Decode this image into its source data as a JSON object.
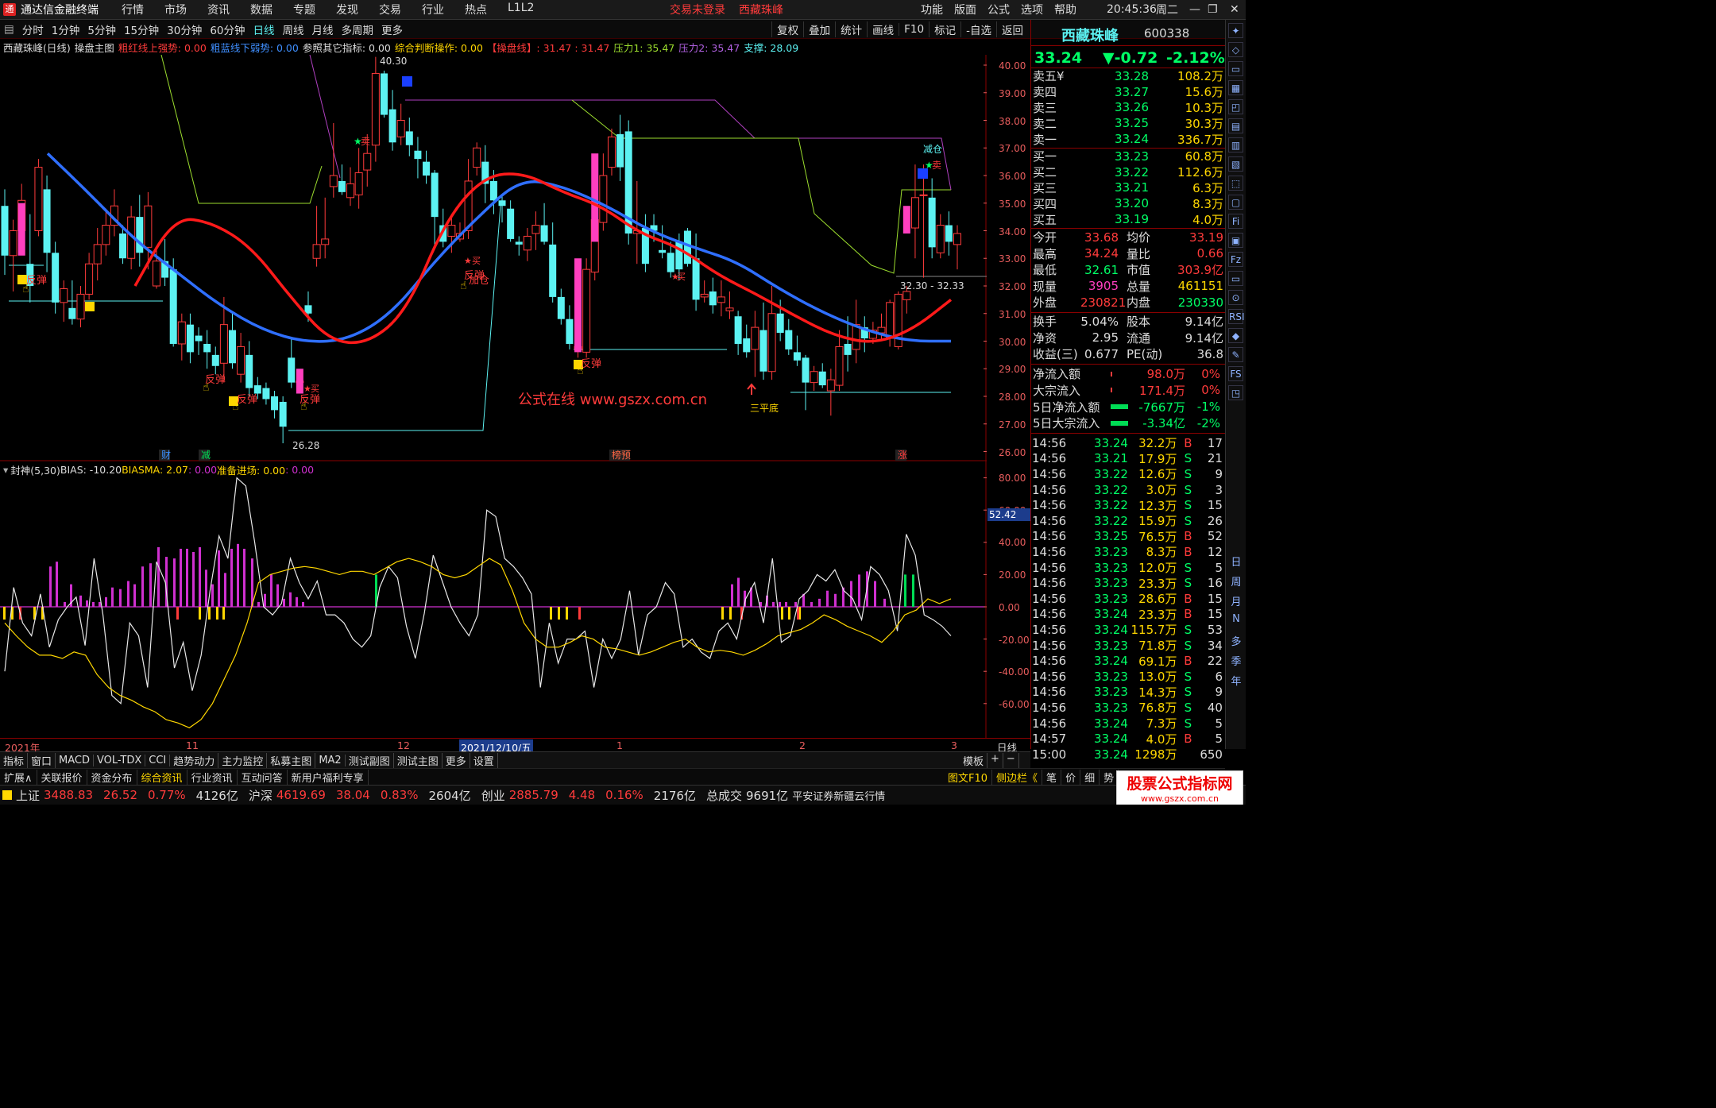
{
  "title_bar": {
    "app": "通达信金融终端",
    "menus": [
      "行情",
      "市场",
      "资讯",
      "数据",
      "专题",
      "发现",
      "交易",
      "行业",
      "热点",
      "L1L2"
    ],
    "login": "交易未登录",
    "stock_name": "西藏珠峰",
    "right_menus": [
      "功能",
      "版面",
      "公式",
      "选项",
      "帮助"
    ],
    "time": "20:45:36",
    "weekday": "周二"
  },
  "period_bar": {
    "periods": [
      "分时",
      "1分钟",
      "5分钟",
      "15分钟",
      "30分钟",
      "60分钟",
      "日线",
      "周线",
      "月线",
      "多周期",
      "更多"
    ],
    "active": "日线",
    "tools": [
      "复权",
      "叠加",
      "统计",
      "画线",
      "F10",
      "标记",
      "-自选",
      "返回"
    ]
  },
  "main_info": {
    "stock": "西藏珠峰(日线)",
    "formula": "操盘主图",
    "red_line": "粗红线上强势: 0.00",
    "blue_line": "粗蓝线下弱势: 0.00",
    "ref": "参照其它指标: 0.00",
    "judge": "综合判断操作: 0.00",
    "pan": "【操盘线】: 31.47 : 31.47",
    "p1": "压力1: 35.47",
    "p2": "压力2: 35.47",
    "support": "支撑: 28.09"
  },
  "price_axis": [
    "40.00",
    "39.00",
    "38.00",
    "37.00",
    "36.00",
    "35.00",
    "34.00",
    "33.00",
    "32.00",
    "31.00",
    "30.00",
    "29.00",
    "28.00",
    "27.00",
    "26.00"
  ],
  "annotations": {
    "high": "40.30",
    "low": "26.28",
    "range": "32.30 - 32.33",
    "rebound": "反弹",
    "buy": "买",
    "sell": "卖",
    "add": "加仓",
    "reduce": "减仓",
    "triple_bottom": "三平底",
    "watermark": "公式在线 www.gszx.com.cn",
    "buy_rebound": "买反弹",
    "markers": [
      "财",
      "减",
      "榜预",
      "涨"
    ]
  },
  "sub_info": {
    "name": "封神(5,30)",
    "bias": "BIAS: -10.20",
    "biasma": "BIASMA: 2.07",
    "v1": ": 0.00",
    "ready": "准备进场: 0.00",
    "v2": ": 0.00"
  },
  "sub_axis": [
    "80.00",
    "60.00",
    "40.00",
    "20.00",
    "0.00",
    "-20.00",
    "-40.00",
    "-60.00"
  ],
  "sub_marker": "52.42",
  "date_axis": {
    "labels": [
      "2021年",
      "11",
      "12",
      "2021/12/10/五",
      "1",
      "2",
      "3"
    ],
    "period": "日线"
  },
  "bottom_tabs": [
    "指标",
    "窗口",
    "MACD",
    "VOL-TDX",
    "CCI",
    "趋势动力",
    "主力监控",
    "私募主图",
    "MA2",
    "测试副图",
    "测试主图",
    "更多",
    "设置"
  ],
  "bottom_tabs_right": [
    "模板",
    "+",
    "−"
  ],
  "bottom_tabs2": [
    "扩展∧",
    "关联报价",
    "资金分布",
    "综合资讯",
    "行业资讯",
    "互动问答",
    "新用户福利专享"
  ],
  "bottom_tabs2_right": [
    "图文F10",
    "侧边栏《",
    "笔",
    "价",
    "细",
    "势"
  ],
  "status_bar": {
    "sh_label": "上证",
    "sh": "3488.83",
    "sh_chg": "26.52",
    "sh_pct": "0.77%",
    "sh_amt": "4126亿",
    "sz_label": "沪深",
    "sz": "4619.69",
    "sz_chg": "38.04",
    "sz_pct": "0.83%",
    "sz_amt": "2604亿",
    "cy_label": "创业",
    "cy": "2885.79",
    "cy_chg": "4.48",
    "cy_pct": "0.16%",
    "cy_amt": "2176亿",
    "total_label": "总成交",
    "total": "9691亿",
    "broker": "平安证券新疆云行情",
    "brand": "股票公式指标网",
    "brand_url": "www.gszx.com.cn"
  },
  "quote": {
    "name": "西藏珠峰",
    "code": "600338",
    "price": "33.24",
    "change": "▼-0.72",
    "pct": "-2.12%",
    "asks": [
      {
        "l": "卖五¥",
        "p": "33.28",
        "v": "108.2万"
      },
      {
        "l": "卖四",
        "p": "33.27",
        "v": "15.6万"
      },
      {
        "l": "卖三",
        "p": "33.26",
        "v": "10.3万"
      },
      {
        "l": "卖二",
        "p": "33.25",
        "v": "30.3万"
      },
      {
        "l": "卖一",
        "p": "33.24",
        "v": "336.7万"
      }
    ],
    "bids": [
      {
        "l": "买一",
        "p": "33.23",
        "v": "60.8万"
      },
      {
        "l": "买二",
        "p": "33.22",
        "v": "112.6万"
      },
      {
        "l": "买三",
        "p": "33.21",
        "v": "6.3万"
      },
      {
        "l": "买四",
        "p": "33.20",
        "v": "8.3万"
      },
      {
        "l": "买五",
        "p": "33.19",
        "v": "4.0万"
      }
    ],
    "stats": [
      [
        "今开",
        "33.68",
        "均价",
        "33.19"
      ],
      [
        "最高",
        "34.24",
        "量比",
        "0.66"
      ],
      [
        "最低",
        "32.61",
        "市值",
        "303.9亿"
      ],
      [
        "现量",
        "3905",
        "总量",
        "461151"
      ],
      [
        "外盘",
        "230821",
        "内盘",
        "230330"
      ]
    ],
    "stats2": [
      [
        "换手",
        "5.04%",
        "股本",
        "9.14亿"
      ],
      [
        "净资",
        "2.95",
        "流通",
        "9.14亿"
      ],
      [
        "收益(三)",
        "0.677",
        "PE(动)",
        "36.8"
      ]
    ],
    "flows": [
      [
        "净流入额",
        "98.0万",
        "0%"
      ],
      [
        "大宗流入",
        "171.4万",
        "0%"
      ],
      [
        "5日净流入额",
        "-7667万",
        "-1%"
      ],
      [
        "5日大宗流入",
        "-3.34亿",
        "-2%"
      ]
    ]
  },
  "ticks": [
    [
      "14:56",
      "33.24",
      "32.2万",
      "B",
      "17"
    ],
    [
      "14:56",
      "33.21",
      "17.9万",
      "S",
      "21"
    ],
    [
      "14:56",
      "33.22",
      "12.6万",
      "S",
      "9"
    ],
    [
      "14:56",
      "33.22",
      "3.0万",
      "S",
      "3"
    ],
    [
      "14:56",
      "33.22",
      "12.3万",
      "S",
      "15"
    ],
    [
      "14:56",
      "33.22",
      "15.9万",
      "S",
      "26"
    ],
    [
      "14:56",
      "33.25",
      "76.5万",
      "B",
      "52"
    ],
    [
      "14:56",
      "33.23",
      "8.3万",
      "B",
      "12"
    ],
    [
      "14:56",
      "33.23",
      "12.0万",
      "S",
      "5"
    ],
    [
      "14:56",
      "33.23",
      "23.3万",
      "S",
      "16"
    ],
    [
      "14:56",
      "33.23",
      "28.6万",
      "B",
      "15"
    ],
    [
      "14:56",
      "33.24",
      "23.3万",
      "B",
      "15"
    ],
    [
      "14:56",
      "33.24",
      "115.7万",
      "S",
      "53"
    ],
    [
      "14:56",
      "33.23",
      "71.8万",
      "S",
      "34"
    ],
    [
      "14:56",
      "33.24",
      "69.1万",
      "B",
      "22"
    ],
    [
      "14:56",
      "33.23",
      "13.0万",
      "S",
      "6"
    ],
    [
      "14:56",
      "33.23",
      "14.3万",
      "S",
      "9"
    ],
    [
      "14:56",
      "33.23",
      "76.8万",
      "S",
      "40"
    ],
    [
      "14:56",
      "33.24",
      "7.3万",
      "S",
      "5"
    ],
    [
      "14:57",
      "33.24",
      "4.0万",
      "B",
      "5"
    ],
    [
      "15:00",
      "33.24",
      "1298万",
      "",
      "650"
    ]
  ],
  "side_icons": [
    "日",
    "周",
    "月",
    "N",
    "多",
    "季",
    "年"
  ],
  "colors": {
    "up": "#ff3b3b",
    "down": "#5cf2f2",
    "yellow": "#ffd700",
    "magenta": "#ff3fbf",
    "blue_ma": "#2f6fff",
    "red_ma": "#ff1a1a",
    "green": "#00ff66",
    "purple": "#b040c0",
    "lime": "#9cdd2e"
  },
  "chart_data": {
    "type": "candlestick",
    "candles": [
      [
        34.9,
        35.5,
        32.4,
        33.1
      ],
      [
        33.1,
        34.4,
        31.8,
        34.0
      ],
      [
        34.0,
        35.7,
        33.4,
        35.1
      ],
      [
        32.8,
        34.6,
        31.4,
        32.0
      ],
      [
        34.0,
        36.6,
        33.8,
        36.3
      ],
      [
        35.5,
        36.0,
        32.5,
        33.2
      ],
      [
        33.2,
        33.6,
        31.0,
        31.4
      ],
      [
        31.4,
        32.2,
        30.7,
        31.9
      ],
      [
        31.2,
        32.2,
        30.6,
        30.8
      ],
      [
        30.8,
        32.0,
        30.5,
        31.7
      ],
      [
        31.7,
        33.2,
        31.5,
        32.8
      ],
      [
        32.8,
        34.1,
        32.2,
        33.5
      ],
      [
        33.5,
        34.8,
        33.1,
        34.2
      ],
      [
        34.2,
        35.5,
        33.8,
        34.9
      ],
      [
        33.9,
        34.2,
        32.8,
        33.0
      ],
      [
        33.0,
        34.9,
        32.6,
        34.5
      ],
      [
        34.5,
        35.3,
        32.7,
        33.2
      ],
      [
        33.4,
        35.4,
        32.6,
        34.9
      ],
      [
        32.0,
        33.3,
        31.9,
        32.9
      ],
      [
        32.9,
        33.7,
        32.0,
        32.3
      ],
      [
        32.6,
        33.0,
        29.8,
        29.9
      ],
      [
        29.9,
        31.0,
        29.3,
        30.7
      ],
      [
        30.6,
        31.0,
        29.2,
        29.6
      ],
      [
        30.2,
        30.5,
        29.5,
        30.0
      ],
      [
        29.9,
        30.4,
        29.0,
        29.6
      ],
      [
        29.5,
        29.8,
        28.8,
        29.1
      ],
      [
        29.2,
        31.6,
        28.5,
        30.6
      ],
      [
        30.4,
        31.0,
        29.0,
        29.2
      ],
      [
        28.8,
        30.3,
        28.5,
        29.8
      ],
      [
        29.5,
        30.0,
        28.0,
        28.3
      ],
      [
        28.4,
        28.7,
        27.9,
        28.1
      ],
      [
        28.3,
        28.5,
        27.7,
        27.9
      ],
      [
        28.0,
        28.2,
        27.2,
        27.5
      ],
      [
        27.8,
        28.0,
        26.3,
        26.9
      ],
      [
        29.4,
        30.1,
        28.3,
        28.5
      ],
      [
        28.5,
        28.6,
        28.4,
        28.55
      ],
      [
        31.3,
        31.8,
        30.7,
        31.0
      ],
      [
        33.0,
        34.9,
        32.7,
        33.5
      ],
      [
        33.5,
        35.2,
        33.0,
        33.7
      ],
      [
        35.6,
        37.9,
        35.2,
        36.0
      ],
      [
        35.8,
        36.4,
        35.3,
        35.4
      ],
      [
        35.2,
        36.3,
        34.9,
        35.7
      ],
      [
        35.3,
        37.0,
        34.8,
        36.1
      ],
      [
        36.2,
        37.5,
        35.6,
        36.8
      ],
      [
        37.1,
        40.3,
        36.5,
        39.7
      ],
      [
        39.7,
        39.8,
        38.1,
        38.2
      ],
      [
        38.4,
        39.1,
        36.9,
        37.2
      ],
      [
        37.4,
        38.6,
        37.1,
        38.0
      ],
      [
        37.6,
        38.1,
        36.7,
        37.1
      ],
      [
        36.9,
        37.4,
        35.9,
        36.6
      ],
      [
        36.5,
        36.9,
        35.7,
        36.0
      ],
      [
        36.1,
        36.2,
        33.4,
        34.5
      ],
      [
        34.2,
        34.8,
        33.4,
        33.6
      ],
      [
        33.8,
        34.5,
        33.2,
        34.2
      ],
      [
        33.7,
        34.3,
        33.6,
        33.9
      ],
      [
        34.0,
        36.6,
        33.7,
        35.8
      ],
      [
        36.3,
        37.2,
        36.0,
        37.0
      ],
      [
        36.5,
        37.1,
        35.0,
        35.7
      ],
      [
        35.8,
        36.2,
        34.6,
        35.1
      ],
      [
        35.1,
        35.3,
        34.3,
        34.9
      ],
      [
        34.8,
        35.1,
        33.6,
        33.7
      ],
      [
        33.6,
        33.8,
        33.1,
        33.5
      ],
      [
        33.3,
        34.1,
        32.9,
        33.8
      ],
      [
        33.9,
        34.7,
        33.3,
        34.2
      ],
      [
        34.2,
        35.0,
        33.5,
        33.6
      ],
      [
        33.5,
        34.3,
        31.4,
        31.6
      ],
      [
        31.6,
        31.9,
        30.6,
        30.8
      ],
      [
        30.8,
        31.3,
        29.7,
        29.9
      ],
      [
        29.7,
        30.1,
        29.4,
        29.8
      ],
      [
        29.6,
        33.0,
        29.4,
        32.6
      ],
      [
        32.5,
        34.7,
        32.2,
        34.4
      ],
      [
        34.3,
        36.8,
        34.0,
        36.0
      ],
      [
        36.3,
        37.7,
        36.0,
        37.4
      ],
      [
        37.5,
        38.2,
        35.8,
        36.3
      ],
      [
        37.6,
        38.0,
        33.5,
        33.9
      ],
      [
        33.9,
        35.8,
        32.8,
        34.0
      ],
      [
        34.1,
        34.6,
        32.5,
        32.8
      ],
      [
        34.2,
        34.6,
        33.6,
        34.0
      ],
      [
        33.3,
        34.2,
        33.0,
        33.2
      ],
      [
        33.2,
        33.6,
        32.3,
        32.5
      ],
      [
        33.6,
        33.9,
        32.2,
        32.6
      ],
      [
        34.0,
        34.1,
        32.7,
        32.8
      ],
      [
        33.0,
        33.9,
        31.1,
        31.5
      ],
      [
        31.6,
        32.2,
        31.4,
        31.7
      ],
      [
        31.8,
        32.3,
        31.0,
        31.3
      ],
      [
        31.4,
        32.2,
        30.9,
        31.6
      ],
      [
        31.1,
        31.8,
        30.8,
        31.2
      ],
      [
        30.9,
        31.1,
        29.5,
        29.9
      ],
      [
        30.1,
        30.6,
        29.4,
        29.6
      ],
      [
        29.7,
        31.1,
        28.7,
        30.5
      ],
      [
        30.4,
        31.4,
        28.6,
        28.9
      ],
      [
        28.9,
        32.0,
        28.6,
        31.0
      ],
      [
        31.0,
        31.5,
        30.0,
        30.3
      ],
      [
        30.4,
        30.8,
        29.5,
        29.7
      ],
      [
        29.6,
        30.2,
        29.1,
        29.3
      ],
      [
        29.4,
        29.5,
        27.5,
        28.5
      ],
      [
        28.5,
        29.1,
        28.2,
        28.9
      ],
      [
        28.9,
        29.2,
        28.3,
        28.4
      ],
      [
        28.2,
        29.0,
        27.3,
        28.6
      ],
      [
        28.4,
        30.4,
        28.2,
        29.8
      ],
      [
        29.9,
        30.9,
        28.9,
        29.5
      ],
      [
        29.7,
        31.5,
        29.2,
        30.6
      ],
      [
        30.5,
        30.9,
        29.6,
        30.1
      ],
      [
        30.1,
        30.7,
        29.9,
        30.4
      ],
      [
        30.3,
        31.0,
        30.0,
        30.5
      ],
      [
        30.1,
        31.5,
        29.8,
        31.4
      ],
      [
        29.8,
        31.8,
        29.7,
        31.7
      ],
      [
        31.5,
        32.0,
        31.0,
        31.8
      ],
      [
        34.1,
        36.4,
        33.0,
        35.2
      ],
      [
        35.3,
        36.4,
        32.3,
        35.3
      ],
      [
        35.2,
        35.9,
        33.0,
        33.4
      ],
      [
        33.2,
        34.6,
        33.0,
        34.2
      ],
      [
        34.2,
        34.7,
        33.1,
        33.6
      ],
      [
        33.5,
        34.2,
        32.6,
        33.9
      ]
    ],
    "ma_blue": [
      36.8,
      35.3,
      33.7,
      32.5,
      31.3,
      30.4,
      29.95,
      30.05,
      31.0,
      32.9,
      34.5,
      35.9,
      35.6,
      34.9,
      34.0,
      33.4,
      32.9,
      31.9,
      31.05,
      30.4,
      30.0,
      30.0
    ],
    "ma_red": [
      32.0,
      34.5,
      34.3,
      33.4,
      31.6,
      30.0,
      29.9,
      31.1,
      34.4,
      36.0,
      36.1,
      35.4,
      34.9,
      33.9,
      33.4,
      32.4,
      31.7,
      30.9,
      30.2,
      29.9,
      30.4,
      31.5
    ],
    "sub_series": {
      "bias": [
        -40,
        12,
        -10,
        -18,
        8,
        -25,
        -8,
        0,
        6,
        -24,
        30,
        -5,
        -55,
        -60,
        -10,
        -18,
        -50,
        28,
        15,
        -38,
        -22,
        -52,
        -30,
        10,
        44,
        30,
        80,
        75,
        40,
        0,
        -5,
        2,
        30,
        15,
        5,
        16,
        -5,
        -5,
        -10,
        -20,
        -25,
        -18,
        12,
        25,
        18,
        -12,
        -32,
        -4,
        32,
        16,
        0,
        -10,
        -18,
        -5,
        60,
        56,
        30,
        25,
        18,
        8,
        -50,
        -10,
        -35,
        -20,
        -20,
        -15,
        -50,
        -20,
        -32,
        -20,
        10,
        -30,
        -5,
        0,
        15,
        8,
        -25,
        -20,
        -28,
        -32,
        -15,
        -10,
        -20,
        5,
        15,
        -10,
        30,
        -22,
        -18,
        5,
        10,
        20,
        16,
        23,
        10,
        5,
        -8,
        25,
        20,
        10,
        -15,
        45,
        32,
        -5,
        -8,
        -12,
        -18
      ],
      "biasma": [
        -10,
        -18,
        -25,
        -30,
        -30,
        -32,
        -28,
        -30,
        -42,
        -50,
        -55,
        -58,
        -62,
        -65,
        -70,
        -72,
        -75,
        -70,
        -60,
        -45,
        -30,
        -10,
        15,
        20,
        22,
        24,
        25,
        24,
        22,
        20,
        22,
        22,
        20,
        24,
        28,
        30,
        28,
        25,
        20,
        18,
        20,
        25,
        30,
        26,
        10,
        -10,
        -20,
        -25,
        -25,
        -22,
        -18,
        -20,
        -25,
        -26,
        -28,
        -30,
        -28,
        -25,
        -22,
        -20,
        -25,
        -28,
        -27,
        -28,
        -30,
        -27,
        -23,
        -18,
        -16,
        -14,
        -10,
        -5,
        -8,
        -12,
        -15,
        -18,
        -22,
        -15,
        -5,
        -2,
        5,
        2,
        5
      ],
      "bars": [
        25,
        28,
        3,
        14,
        7,
        4,
        3,
        3,
        6,
        12,
        11,
        16,
        14,
        25,
        27,
        37,
        31,
        30,
        36,
        36,
        34,
        37,
        23,
        14,
        35,
        21,
        36,
        39,
        36,
        30,
        3,
        8,
        20,
        14,
        5,
        9,
        6,
        3
      ]
    }
  }
}
